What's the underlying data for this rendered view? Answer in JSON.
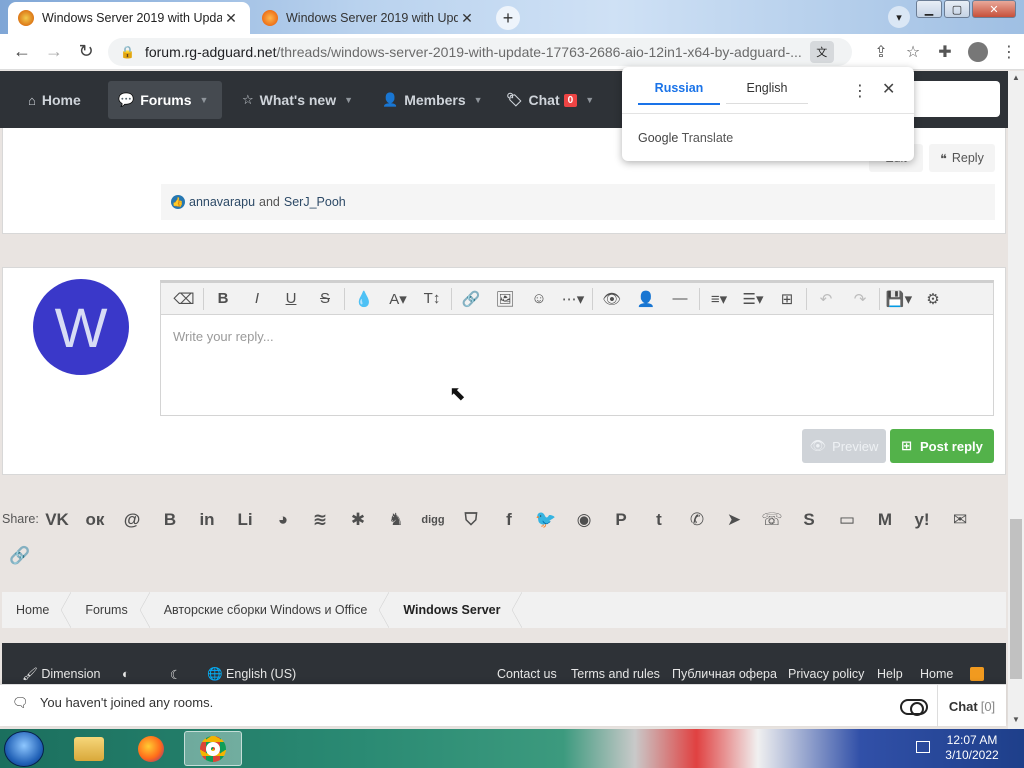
{
  "browser": {
    "tabs": [
      {
        "title": "Windows Server 2019 with Upda",
        "active": true
      },
      {
        "title": "Windows Server 2019 with Upda",
        "active": false
      }
    ],
    "url_host": "forum.rg-adguard.net",
    "url_path": "/threads/windows-server-2019-with-update-17763-2686-aio-12in1-x64-by-adguard-..."
  },
  "forum_nav": {
    "items": [
      {
        "label": "Home"
      },
      {
        "label": "Forums"
      },
      {
        "label": "What's new"
      },
      {
        "label": "Members"
      },
      {
        "label": "Chat"
      }
    ],
    "chat_badge": "0"
  },
  "post": {
    "edit_label": "Edit",
    "reply_label": "Reply",
    "reactions": {
      "user1": "annavarapu",
      "joiner": "and",
      "user2": "SerJ_Pooh"
    }
  },
  "editor": {
    "avatar_letter": "W",
    "placeholder": "Write your reply...",
    "preview_label": "Preview",
    "post_reply_label": "Post reply"
  },
  "share": {
    "label": "Share:",
    "icons": [
      "vk-icon",
      "odnoklassniki-icon",
      "at-mail-icon",
      "blogger-icon",
      "linkedin-icon",
      "livejournal-icon",
      "browser-globe-icon",
      "buffer-icon",
      "asterisk-icon",
      "evernote-icon",
      "digg-icon",
      "pocket-icon",
      "facebook-icon",
      "twitter-icon",
      "reddit-icon",
      "pinterest-icon",
      "tumblr-icon",
      "whatsapp-icon",
      "telegram-icon",
      "viber-icon",
      "skype-icon",
      "line-icon",
      "gmail-icon",
      "yahoo-icon",
      "email-icon",
      "link-icon"
    ]
  },
  "breadcrumb": [
    "Home",
    "Forums",
    "Авторские сборки Windows и Office",
    "Windows Server"
  ],
  "footer": {
    "dimension": "Dimension",
    "language": "English (US)",
    "links": [
      "Contact us",
      "Terms and rules",
      "Публичная офера",
      "Privacy policy",
      "Help",
      "Home"
    ]
  },
  "chat": {
    "message": "You haven't joined any rooms.",
    "label": "Chat",
    "count": "[0]"
  },
  "translate_popup": {
    "tab_selected": "Russian",
    "tab_other": "English",
    "brand": "Google",
    "brand_suffix": "Translate"
  },
  "taskbar": {
    "time": "12:07 AM",
    "date": "3/10/2022"
  },
  "colors": {
    "navbar": "#2e3237",
    "post_reply": "#53b24a",
    "avatar": "#3a38c9",
    "link_blue": "#1a73e8"
  }
}
